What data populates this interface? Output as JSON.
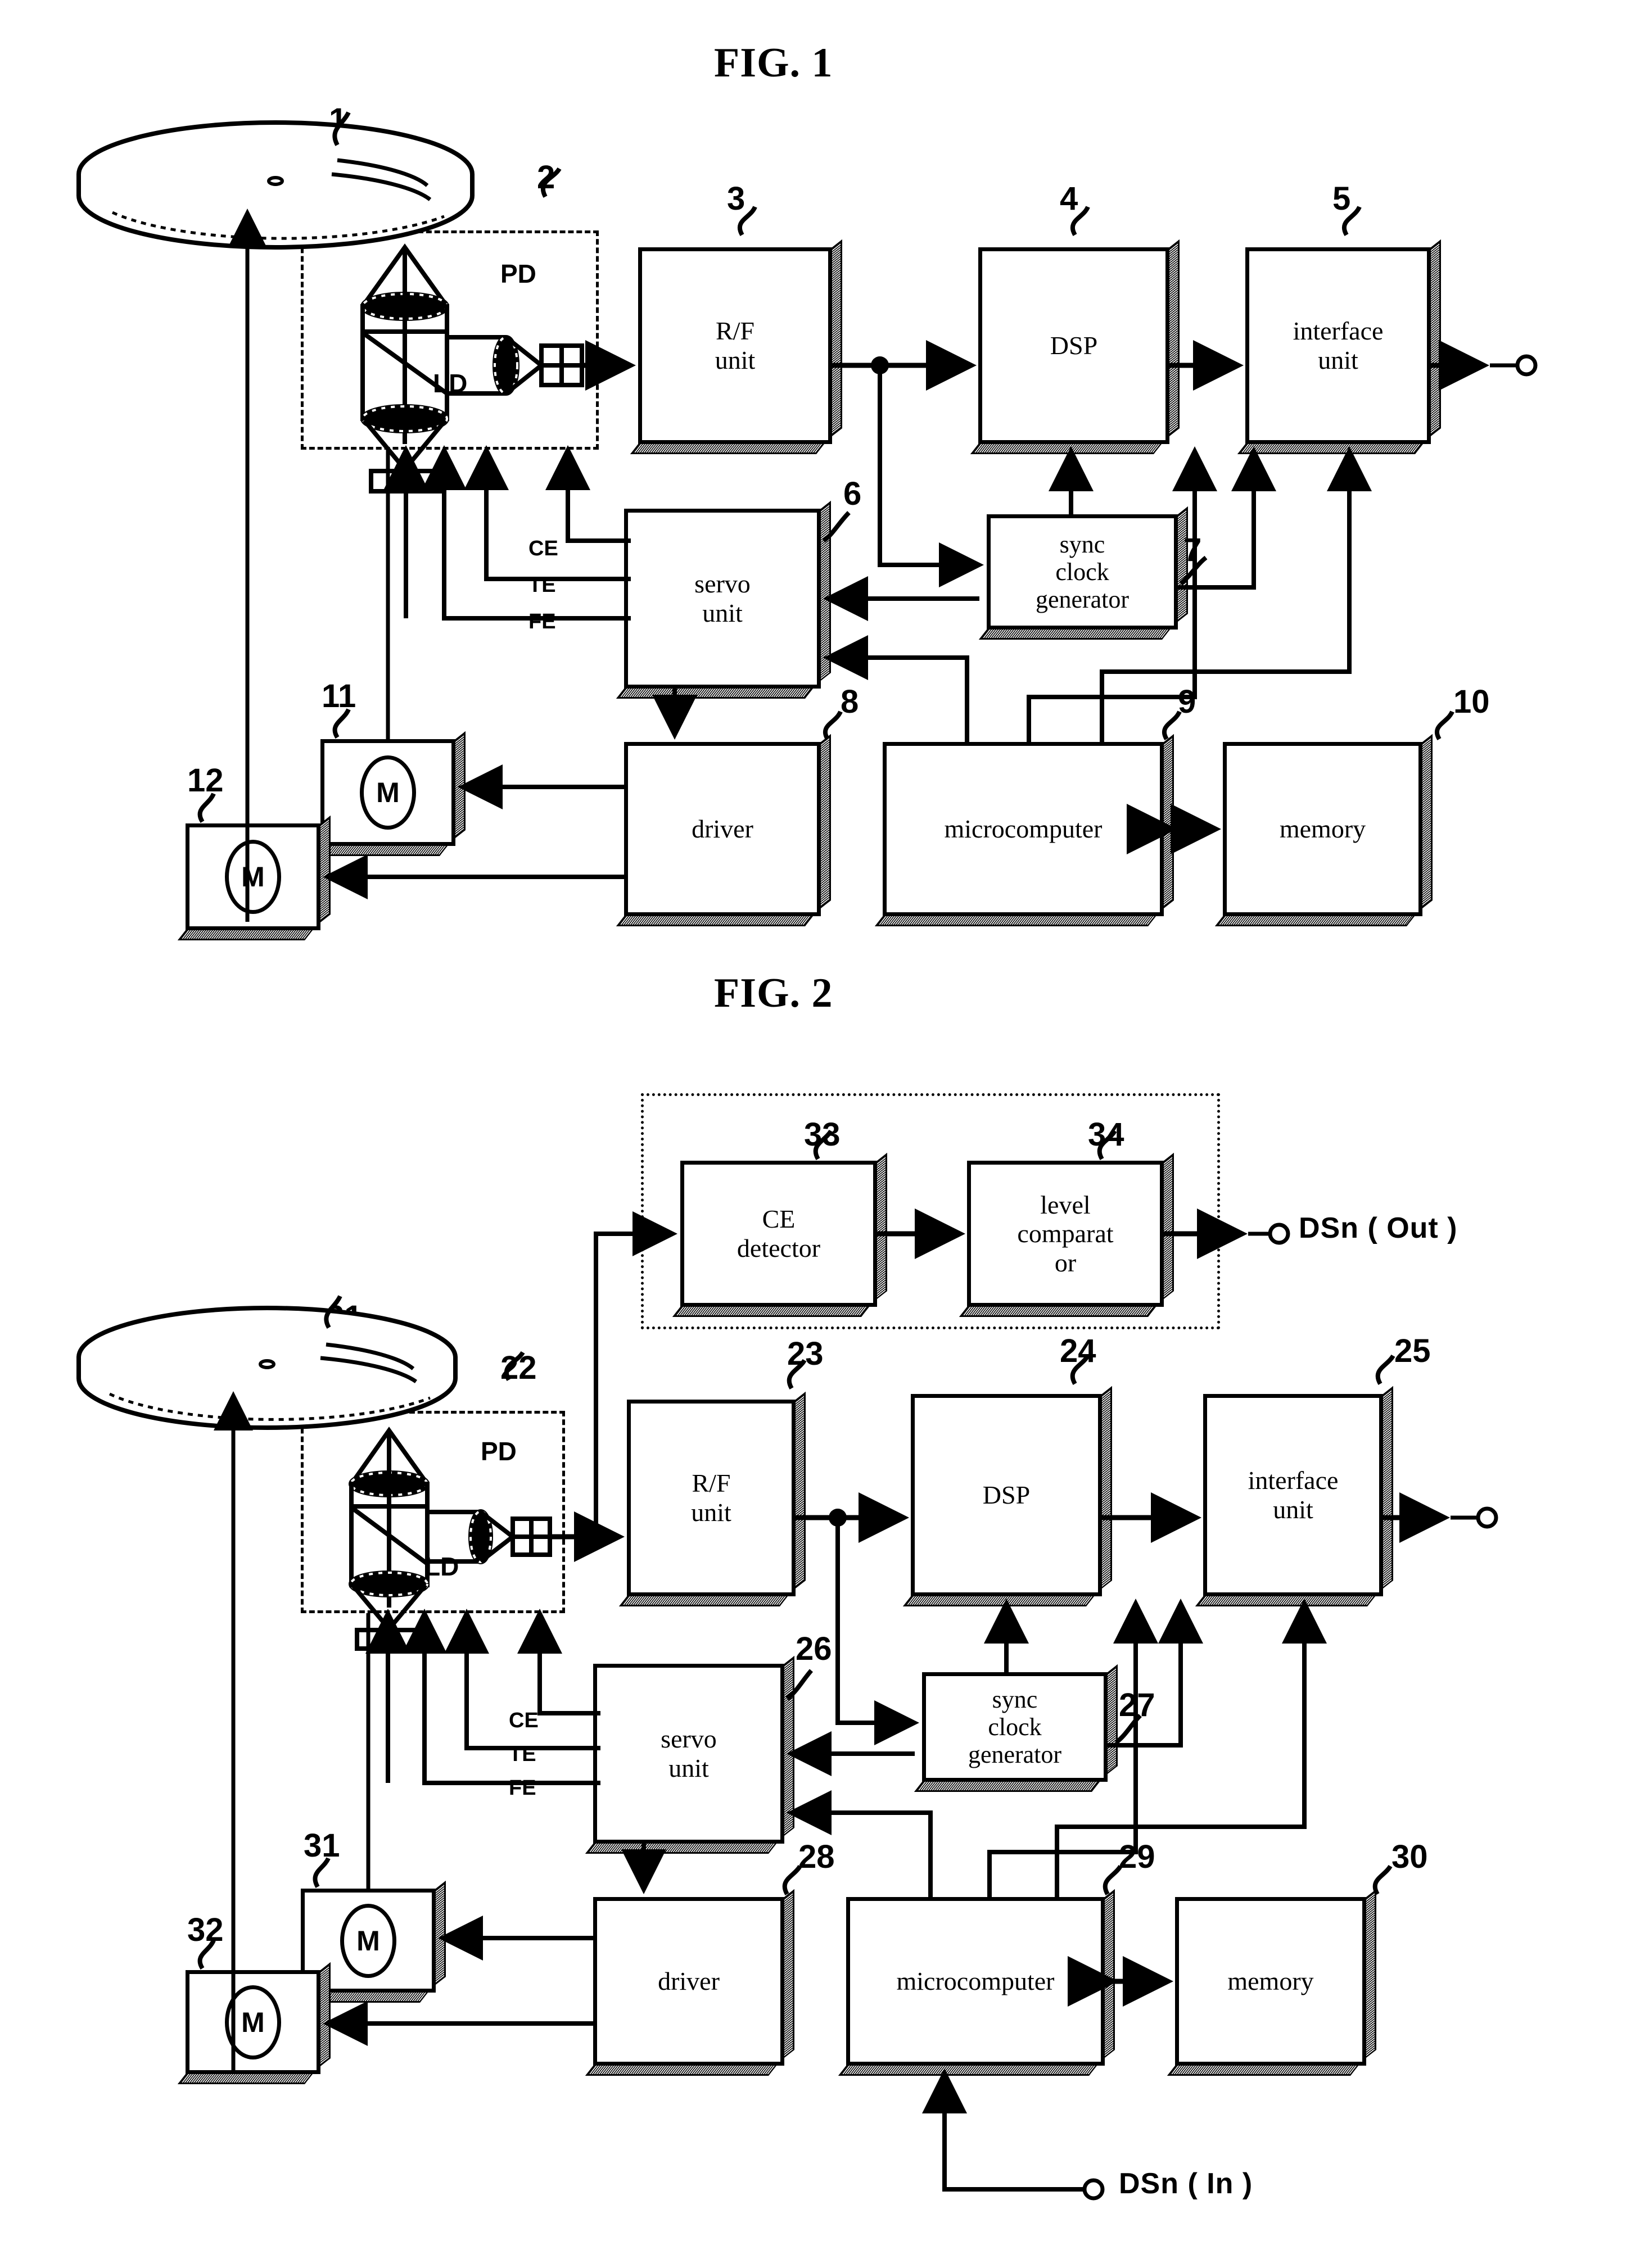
{
  "figures": [
    {
      "title": "FIG. 1",
      "ref_numbers": [
        "1",
        "2",
        "3",
        "4",
        "5",
        "6",
        "7",
        "8",
        "9",
        "10",
        "11",
        "12"
      ],
      "blocks": [
        {
          "ref": "3",
          "label": "R/F\nunit"
        },
        {
          "ref": "4",
          "label": "DSP"
        },
        {
          "ref": "5",
          "label": "interface\nunit"
        },
        {
          "ref": "6",
          "label": "servo\nunit"
        },
        {
          "ref": "7",
          "label": "sync\nclock\ngenerator"
        },
        {
          "ref": "8",
          "label": "driver"
        },
        {
          "ref": "9",
          "label": "microcomputer"
        },
        {
          "ref": "10",
          "label": "memory"
        },
        {
          "ref": "11",
          "label": "M"
        },
        {
          "ref": "12",
          "label": "M"
        }
      ],
      "optics": {
        "pd": "PD",
        "ld": "LD",
        "disc_ref": "1",
        "pickup_ref": "2"
      },
      "signals": [
        "CE",
        "TE",
        "FE"
      ]
    },
    {
      "title": "FIG. 2",
      "ref_numbers": [
        "21",
        "22",
        "23",
        "24",
        "25",
        "26",
        "27",
        "28",
        "29",
        "30",
        "31",
        "32",
        "33",
        "34"
      ],
      "blocks": [
        {
          "ref": "33",
          "label": "CE\ndetector"
        },
        {
          "ref": "34",
          "label": "level\ncomparat\nor"
        },
        {
          "ref": "23",
          "label": "R/F\nunit"
        },
        {
          "ref": "24",
          "label": "DSP"
        },
        {
          "ref": "25",
          "label": "interface\nunit"
        },
        {
          "ref": "26",
          "label": "servo\nunit"
        },
        {
          "ref": "27",
          "label": "sync\nclock\ngenerator"
        },
        {
          "ref": "28",
          "label": "driver"
        },
        {
          "ref": "29",
          "label": "microcomputer"
        },
        {
          "ref": "30",
          "label": "memory"
        },
        {
          "ref": "31",
          "label": "M"
        },
        {
          "ref": "32",
          "label": "M"
        }
      ],
      "optics": {
        "pd": "PD",
        "ld": "LD",
        "disc_ref": "21",
        "pickup_ref": "22"
      },
      "signals": [
        "CE",
        "TE",
        "FE"
      ],
      "ports": {
        "out": "DSn ( Out )",
        "in": "DSn ( In )"
      }
    }
  ],
  "fig1": {
    "title": "FIG. 1",
    "ref1": "1",
    "ref2": "2",
    "ref3": "3",
    "ref4": "4",
    "ref5": "5",
    "ref6": "6",
    "ref7": "7",
    "ref8": "8",
    "ref9": "9",
    "ref10": "10",
    "ref11": "11",
    "ref12": "12",
    "rf_l1": "R/F",
    "rf_l2": "unit",
    "dsp": "DSP",
    "if_l1": "interface",
    "if_l2": "unit",
    "servo_l1": "servo",
    "servo_l2": "unit",
    "sync_l1": "sync",
    "sync_l2": "clock",
    "sync_l3": "generator",
    "driver": "driver",
    "micro": "microcomputer",
    "memory": "memory",
    "motor11": "M",
    "motor12": "M",
    "pd": "PD",
    "ld": "LD",
    "ce": "CE",
    "te": "TE",
    "fe": "FE"
  },
  "fig2": {
    "title": "FIG. 2",
    "ref21": "21",
    "ref22": "22",
    "ref23": "23",
    "ref24": "24",
    "ref25": "25",
    "ref26": "26",
    "ref27": "27",
    "ref28": "28",
    "ref29": "29",
    "ref30": "30",
    "ref31": "31",
    "ref32": "32",
    "ref33": "33",
    "ref34": "34",
    "ce_det_l1": "CE",
    "ce_det_l2": "detector",
    "lvl_l1": "level",
    "lvl_l2": "comparat",
    "lvl_l3": "or",
    "rf_l1": "R/F",
    "rf_l2": "unit",
    "dsp": "DSP",
    "if_l1": "interface",
    "if_l2": "unit",
    "servo_l1": "servo",
    "servo_l2": "unit",
    "sync_l1": "sync",
    "sync_l2": "clock",
    "sync_l3": "generator",
    "driver": "driver",
    "micro": "microcomputer",
    "memory": "memory",
    "motor31": "M",
    "motor32": "M",
    "pd": "PD",
    "ld": "LD",
    "ce": "CE",
    "te": "TE",
    "fe": "FE",
    "dsn_out": "DSn ( Out )",
    "dsn_in": "DSn ( In )"
  },
  "colors": {
    "ink": "#000000",
    "paper": "#ffffff"
  }
}
